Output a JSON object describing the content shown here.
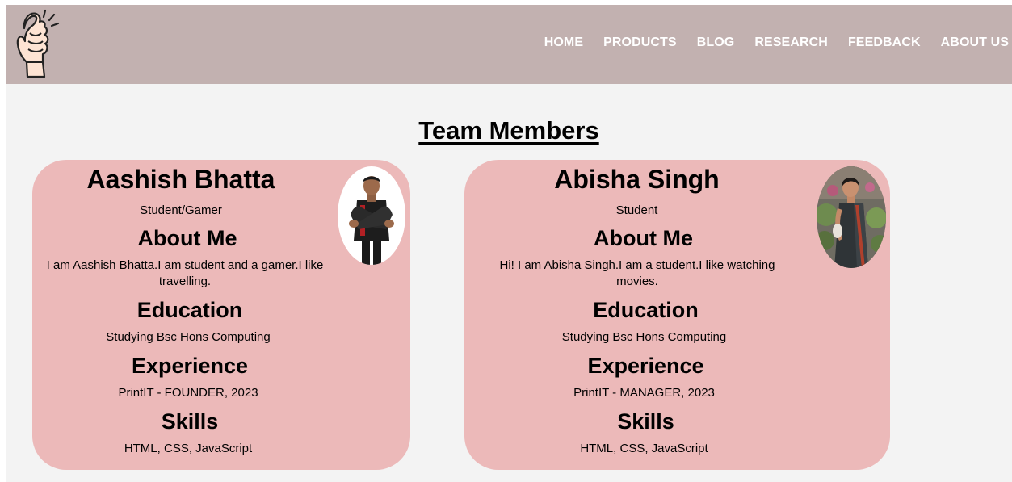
{
  "nav": {
    "items": [
      "HOME",
      "PRODUCTS",
      "BLOG",
      "RESEARCH",
      "FEEDBACK",
      "ABOUT US"
    ]
  },
  "section": {
    "title": "Team Members"
  },
  "members": [
    {
      "name": "Aashish Bhatta",
      "role": "Student/Gamer",
      "about_heading": "About Me",
      "about_text": "I am Aashish Bhatta.I am student and a gamer.I like travelling.",
      "education_heading": "Education",
      "education_text": "Studying Bsc Hons Computing",
      "experience_heading": "Experience",
      "experience_text": "PrintIT - FOUNDER, 2023",
      "skills_heading": "Skills",
      "skills_text": "HTML, CSS, JavaScript"
    },
    {
      "name": "Abisha Singh",
      "role": "Student",
      "about_heading": "About Me",
      "about_text": "Hi! I am Abisha Singh.I am a student.I like watching movies.",
      "education_heading": "Education",
      "education_text": "Studying Bsc Hons Computing",
      "experience_heading": "Experience",
      "experience_text": "PrintIT - MANAGER, 2023",
      "skills_heading": "Skills",
      "skills_text": "HTML, CSS, JavaScript"
    }
  ],
  "colors": {
    "navbar_bg": "#c2b1b0",
    "page_bg": "#f3f3f3",
    "card_bg": "#ecb9b9",
    "nav_text": "#ffffff"
  },
  "icons": {
    "logo": "finger-snap-hand-icon"
  }
}
